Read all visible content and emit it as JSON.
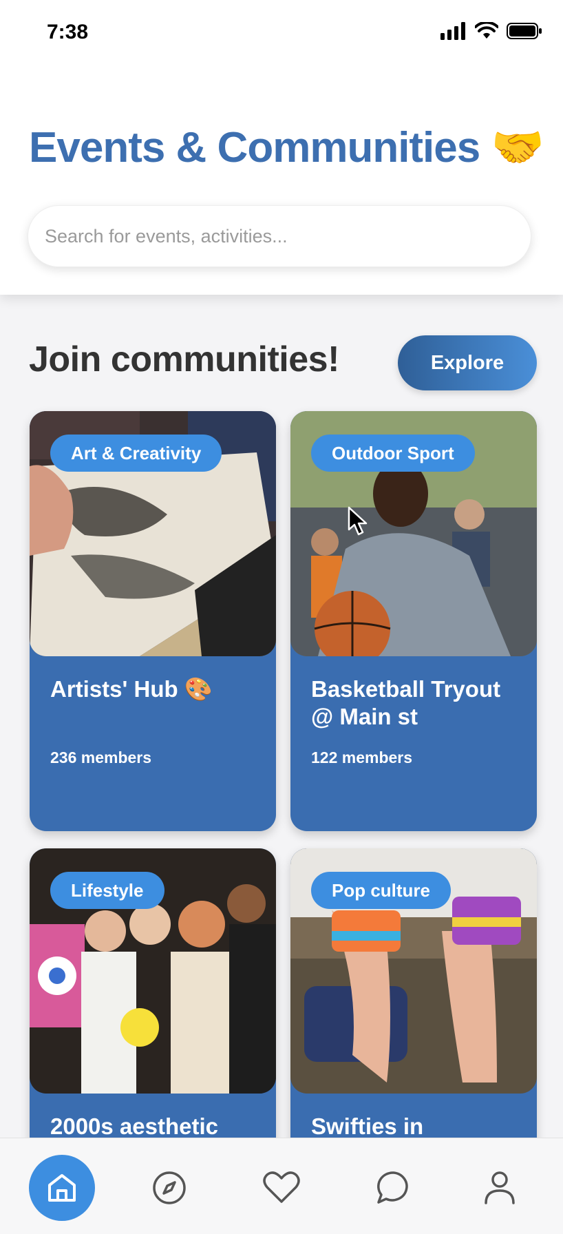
{
  "status_bar": {
    "time": "7:38",
    "icons": [
      "signal-icon",
      "wifi-icon",
      "battery-icon"
    ]
  },
  "header": {
    "title": "Events & Communities 🤝",
    "search_placeholder": "Search for events, activities..."
  },
  "section": {
    "title": "Join communities!",
    "explore_label": "Explore"
  },
  "communities": [
    {
      "tag": "Art & Creativity",
      "title": "Artists' Hub 🎨",
      "members": "236 members"
    },
    {
      "tag": "Outdoor Sport",
      "title": "Basketball Tryout @ Main st",
      "members": "122 members"
    },
    {
      "tag": "Lifestyle",
      "title": "2000s aesthetic",
      "members": ""
    },
    {
      "tag": "Pop culture",
      "title": "Swifties in",
      "members": ""
    }
  ],
  "tab_bar": {
    "items": [
      {
        "icon": "home-icon",
        "active": true
      },
      {
        "icon": "compass-icon",
        "active": false
      },
      {
        "icon": "heart-icon",
        "active": false
      },
      {
        "icon": "chat-icon",
        "active": false
      },
      {
        "icon": "profile-icon",
        "active": false
      }
    ]
  },
  "colors": {
    "brand_blue": "#3d6fb0",
    "card_blue": "#3a6db0",
    "chip_blue": "#3d8ee0",
    "text_dark": "#333333"
  }
}
